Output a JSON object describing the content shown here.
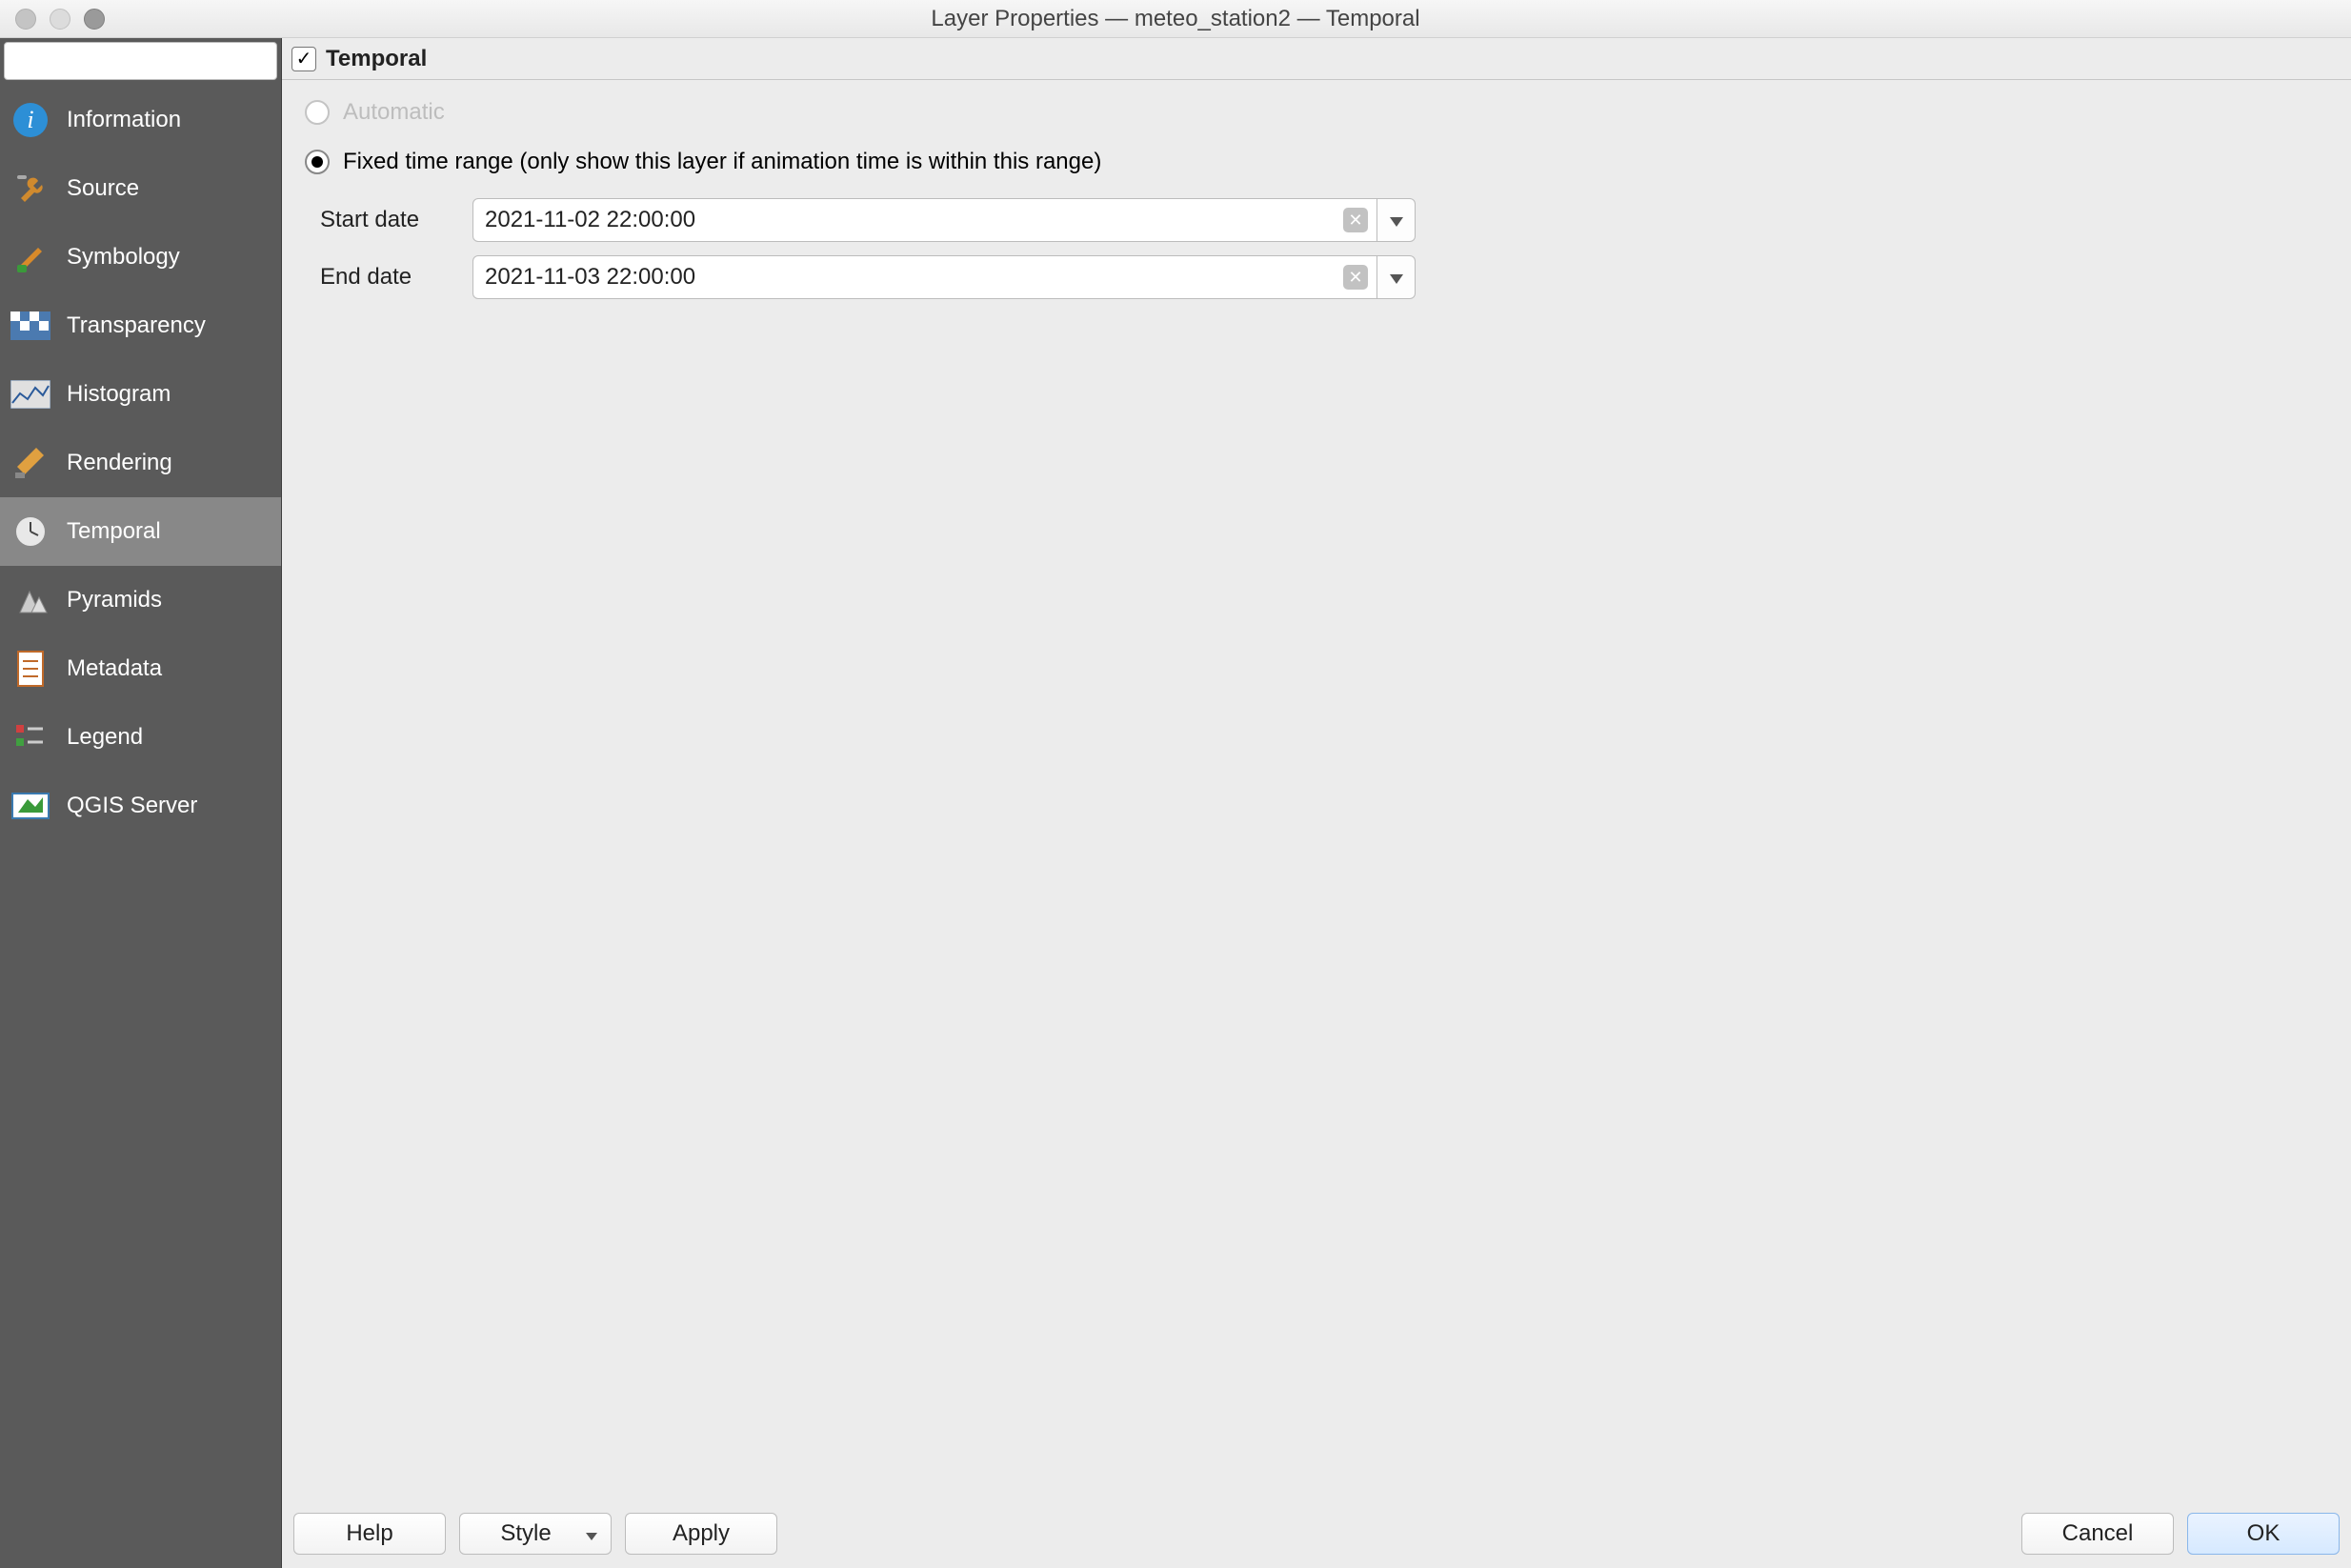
{
  "window": {
    "title": "Layer Properties — meteo_station2 — Temporal"
  },
  "sidebar": {
    "search_placeholder": "",
    "items": [
      {
        "label": "Information"
      },
      {
        "label": "Source"
      },
      {
        "label": "Symbology"
      },
      {
        "label": "Transparency"
      },
      {
        "label": "Histogram"
      },
      {
        "label": "Rendering"
      },
      {
        "label": "Temporal"
      },
      {
        "label": "Pyramids"
      },
      {
        "label": "Metadata"
      },
      {
        "label": "Legend"
      },
      {
        "label": "QGIS Server"
      }
    ]
  },
  "panel": {
    "checkbox_checked_glyph": "✓",
    "title": "Temporal",
    "option_automatic": "Automatic",
    "option_fixed": "Fixed time range (only show this layer if animation time is within this range)",
    "start_label": "Start date",
    "start_value": "2021-11-02 22:00:00",
    "end_label": "End date",
    "end_value": "2021-11-03 22:00:00"
  },
  "footer": {
    "help": "Help",
    "style": "Style",
    "apply": "Apply",
    "cancel": "Cancel",
    "ok": "OK"
  }
}
